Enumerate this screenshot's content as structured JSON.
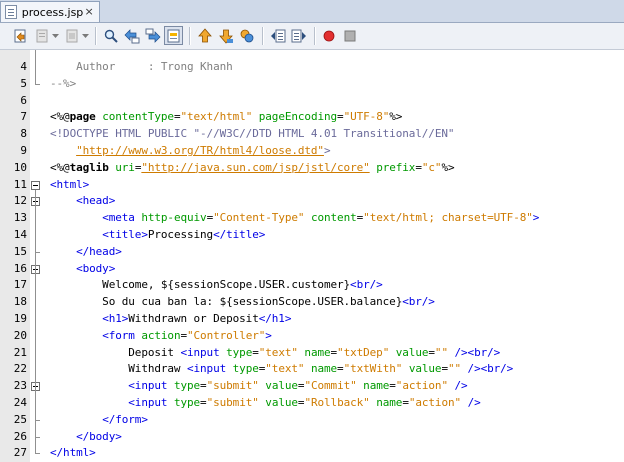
{
  "tab": {
    "title": "process.jsp",
    "close_label": "×"
  },
  "toolbar": {
    "buttons": [
      {
        "name": "back-to-last-edit-icon"
      },
      {
        "name": "toggle-bookmark-icon"
      },
      {
        "name": "dropdown-icon"
      },
      {
        "name": "find-selection-icon"
      },
      {
        "name": "find-previous-icon"
      },
      {
        "name": "find-next-icon"
      },
      {
        "name": "toggle-highlight-icon"
      },
      {
        "name": "previous-bookmark-icon"
      },
      {
        "name": "next-bookmark-icon"
      },
      {
        "name": "toggle-rectangular-icon"
      },
      {
        "name": "shift-left-icon"
      },
      {
        "name": "shift-right-icon"
      },
      {
        "name": "start-macro-icon"
      },
      {
        "name": "stop-macro-icon"
      }
    ]
  },
  "editor": {
    "lines": [
      {
        "n": "4",
        "parts": [
          [
            "c-com",
            "    Author     : Trong Khanh"
          ]
        ]
      },
      {
        "n": "5",
        "parts": [
          [
            "c-com",
            "--%>"
          ]
        ]
      },
      {
        "n": "6",
        "parts": [
          [
            "",
            ""
          ]
        ]
      },
      {
        "n": "7",
        "parts": [
          [
            "c-el",
            "<%@"
          ],
          [
            "c-kw",
            "page"
          ],
          [
            "c-el",
            " "
          ],
          [
            "c-attr",
            "contentType"
          ],
          [
            "c-el",
            "="
          ],
          [
            "c-str",
            "\"text/html\""
          ],
          [
            "c-el",
            " "
          ],
          [
            "c-attr",
            "pageEncoding"
          ],
          [
            "c-el",
            "="
          ],
          [
            "c-str",
            "\"UTF-8\""
          ],
          [
            "c-el",
            "%>"
          ]
        ]
      },
      {
        "n": "8",
        "parts": [
          [
            "c-doc",
            "<!DOCTYPE HTML PUBLIC \"-//W3C//DTD HTML 4.01 Transitional//EN\""
          ]
        ]
      },
      {
        "n": "9",
        "parts": [
          [
            "c-doc",
            "    "
          ],
          [
            "c-url",
            "\"http://www.w3.org/TR/html4/loose.dtd\""
          ],
          [
            "c-doc",
            ">"
          ]
        ]
      },
      {
        "n": "10",
        "parts": [
          [
            "c-el",
            "<%@"
          ],
          [
            "c-kw",
            "taglib"
          ],
          [
            "c-el",
            " "
          ],
          [
            "c-attr",
            "uri"
          ],
          [
            "c-el",
            "="
          ],
          [
            "c-url",
            "\"http://java.sun.com/jsp/jstl/core\""
          ],
          [
            "c-el",
            " "
          ],
          [
            "c-attr",
            "prefix"
          ],
          [
            "c-el",
            "="
          ],
          [
            "c-str",
            "\"c\""
          ],
          [
            "c-el",
            "%>"
          ]
        ]
      },
      {
        "n": "11",
        "parts": [
          [
            "c-tag",
            "<html>"
          ]
        ]
      },
      {
        "n": "12",
        "parts": [
          [
            "c-el",
            "    "
          ],
          [
            "c-tag",
            "<head>"
          ]
        ]
      },
      {
        "n": "13",
        "parts": [
          [
            "c-el",
            "        "
          ],
          [
            "c-tag",
            "<meta"
          ],
          [
            "c-el",
            " "
          ],
          [
            "c-attr",
            "http-equiv"
          ],
          [
            "c-el",
            "="
          ],
          [
            "c-str",
            "\"Content-Type\""
          ],
          [
            "c-el",
            " "
          ],
          [
            "c-attr",
            "content"
          ],
          [
            "c-el",
            "="
          ],
          [
            "c-str",
            "\"text/html; charset=UTF-8\""
          ],
          [
            "c-tag",
            ">"
          ]
        ]
      },
      {
        "n": "14",
        "parts": [
          [
            "c-el",
            "        "
          ],
          [
            "c-tag",
            "<title>"
          ],
          [
            "c-el",
            "Processing"
          ],
          [
            "c-tag",
            "</title>"
          ]
        ]
      },
      {
        "n": "15",
        "parts": [
          [
            "c-el",
            "    "
          ],
          [
            "c-tag",
            "</head>"
          ]
        ]
      },
      {
        "n": "16",
        "parts": [
          [
            "c-el",
            "    "
          ],
          [
            "c-tag",
            "<body>"
          ]
        ]
      },
      {
        "n": "17",
        "parts": [
          [
            "c-el",
            "        Welcome, ${sessionScope.USER.customer}"
          ],
          [
            "c-tag",
            "<br/>"
          ]
        ]
      },
      {
        "n": "18",
        "parts": [
          [
            "c-el",
            "        So du cua ban la: ${sessionScope.USER.balance}"
          ],
          [
            "c-tag",
            "<br/>"
          ]
        ]
      },
      {
        "n": "19",
        "parts": [
          [
            "c-el",
            "        "
          ],
          [
            "c-tag",
            "<h1>"
          ],
          [
            "c-el",
            "Withdrawn or Deposit"
          ],
          [
            "c-tag",
            "</h1>"
          ]
        ]
      },
      {
        "n": "20",
        "parts": [
          [
            "c-el",
            "        "
          ],
          [
            "c-tag",
            "<form"
          ],
          [
            "c-el",
            " "
          ],
          [
            "c-attr",
            "action"
          ],
          [
            "c-el",
            "="
          ],
          [
            "c-str",
            "\"Controller\""
          ],
          [
            "c-tag",
            ">"
          ]
        ]
      },
      {
        "n": "21",
        "parts": [
          [
            "c-el",
            "            Deposit "
          ],
          [
            "c-tag",
            "<input"
          ],
          [
            "c-el",
            " "
          ],
          [
            "c-attr",
            "type"
          ],
          [
            "c-el",
            "="
          ],
          [
            "c-str",
            "\"text\""
          ],
          [
            "c-el",
            " "
          ],
          [
            "c-attr",
            "name"
          ],
          [
            "c-el",
            "="
          ],
          [
            "c-str",
            "\"txtDep\""
          ],
          [
            "c-el",
            " "
          ],
          [
            "c-attr",
            "value"
          ],
          [
            "c-el",
            "="
          ],
          [
            "c-str",
            "\"\""
          ],
          [
            "c-el",
            " "
          ],
          [
            "c-tag",
            "/>"
          ],
          [
            "c-tag",
            "<br/>"
          ]
        ]
      },
      {
        "n": "22",
        "parts": [
          [
            "c-el",
            "            Withdraw "
          ],
          [
            "c-tag",
            "<input"
          ],
          [
            "c-el",
            " "
          ],
          [
            "c-attr",
            "type"
          ],
          [
            "c-el",
            "="
          ],
          [
            "c-str",
            "\"text\""
          ],
          [
            "c-el",
            " "
          ],
          [
            "c-attr",
            "name"
          ],
          [
            "c-el",
            "="
          ],
          [
            "c-str",
            "\"txtWith\""
          ],
          [
            "c-el",
            " "
          ],
          [
            "c-attr",
            "value"
          ],
          [
            "c-el",
            "="
          ],
          [
            "c-str",
            "\"\""
          ],
          [
            "c-el",
            " "
          ],
          [
            "c-tag",
            "/>"
          ],
          [
            "c-tag",
            "<br/>"
          ]
        ]
      },
      {
        "n": "23",
        "parts": [
          [
            "c-el",
            "            "
          ],
          [
            "c-tag",
            "<input"
          ],
          [
            "c-el",
            " "
          ],
          [
            "c-attr",
            "type"
          ],
          [
            "c-el",
            "="
          ],
          [
            "c-str",
            "\"submit\""
          ],
          [
            "c-el",
            " "
          ],
          [
            "c-attr",
            "value"
          ],
          [
            "c-el",
            "="
          ],
          [
            "c-str",
            "\"Commit\""
          ],
          [
            "c-el",
            " "
          ],
          [
            "c-attr",
            "name"
          ],
          [
            "c-el",
            "="
          ],
          [
            "c-str",
            "\"action\""
          ],
          [
            "c-el",
            " "
          ],
          [
            "c-tag",
            "/>"
          ]
        ]
      },
      {
        "n": "24",
        "parts": [
          [
            "c-el",
            "            "
          ],
          [
            "c-tag",
            "<input"
          ],
          [
            "c-el",
            " "
          ],
          [
            "c-attr",
            "type"
          ],
          [
            "c-el",
            "="
          ],
          [
            "c-str",
            "\"submit\""
          ],
          [
            "c-el",
            " "
          ],
          [
            "c-attr",
            "value"
          ],
          [
            "c-el",
            "="
          ],
          [
            "c-str",
            "\"Rollback\""
          ],
          [
            "c-el",
            " "
          ],
          [
            "c-attr",
            "name"
          ],
          [
            "c-el",
            "="
          ],
          [
            "c-str",
            "\"action\""
          ],
          [
            "c-el",
            " "
          ],
          [
            "c-tag",
            "/>"
          ]
        ]
      },
      {
        "n": "25",
        "parts": [
          [
            "c-el",
            "        "
          ],
          [
            "c-tag",
            "</form>"
          ]
        ]
      },
      {
        "n": "26",
        "parts": [
          [
            "c-el",
            "    "
          ],
          [
            "c-tag",
            "</body>"
          ]
        ]
      },
      {
        "n": "27",
        "parts": [
          [
            "c-tag",
            "</html>"
          ]
        ]
      }
    ]
  }
}
